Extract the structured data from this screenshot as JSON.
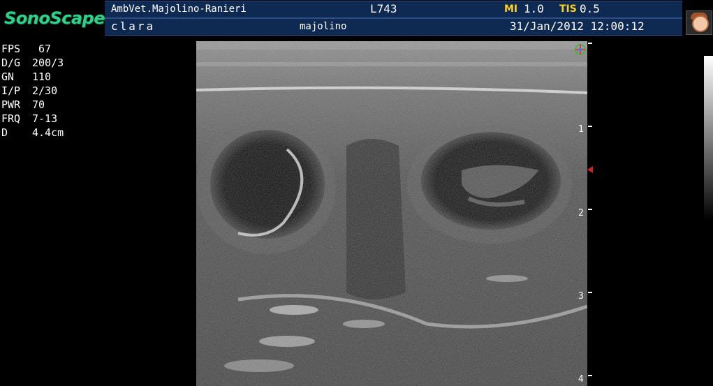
{
  "header": {
    "logo": "SonoScape",
    "institution": "AmbVet.Majolino-Ranieri",
    "probe": "L743",
    "mi_label": "MI",
    "mi_value": "1.0",
    "tis_label": "TIS",
    "tis_value": "0.5",
    "patient": "clara",
    "operator": "majolino",
    "datetime": "31/Jan/2012 12:00:12"
  },
  "params": [
    {
      "label": "FPS",
      "value": " 67"
    },
    {
      "label": "D/G",
      "value": "200/3"
    },
    {
      "label": "GN",
      "value": "110"
    },
    {
      "label": "I/P",
      "value": "2/30"
    },
    {
      "label": "PWR",
      "value": "70"
    },
    {
      "label": "FRQ",
      "value": "7-13"
    },
    {
      "label": "D",
      "value": "4.4cm"
    }
  ],
  "depth_scale": {
    "labels": [
      "1",
      "2",
      "3",
      "4"
    ]
  },
  "icons": {
    "orientation": "orientation-marker-icon",
    "focus": "focus-marker-icon",
    "avatar": "user-avatar-icon"
  },
  "colors": {
    "header_bar": "#0f2a52",
    "logo": "#2fd08a",
    "highlight": "#ffd21f",
    "focus": "#d42020"
  }
}
